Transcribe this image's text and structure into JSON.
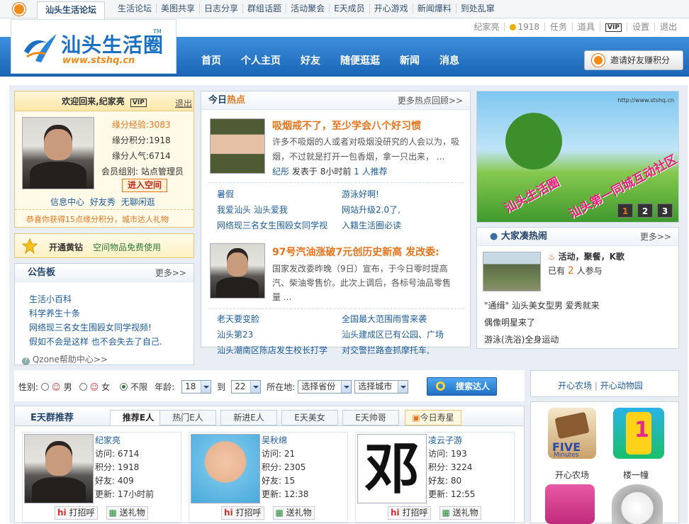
{
  "topbar": {
    "current_tab": "汕头生活论坛",
    "nav": [
      "生活论坛",
      "美图共享",
      "日志分享",
      "群组话题",
      "活动聚会",
      "E天成员",
      "开心游戏",
      "新闻爆料",
      "到处乱窜"
    ],
    "user": {
      "name": "纪家亮",
      "coins": "1918",
      "task": "任务",
      "props": "道具",
      "vip": "VIP",
      "settings": "设置",
      "logout": "退出"
    }
  },
  "header": {
    "logo_cn": "汕头生活圈",
    "logo_url": "www.stshq.cn",
    "logo_tm": "TM",
    "nav": [
      "首页",
      "个人主页",
      "好友",
      "随便逛逛",
      "新闻",
      "消息"
    ],
    "invite": "邀请好友赚积分"
  },
  "welcome": {
    "title": "欢迎回来,纪家亮",
    "vip": "VIP",
    "logout": "退出",
    "stats": [
      "缘分经验:3083",
      "缘分积分:1918",
      "缘分人气:6714"
    ],
    "group": "会员组别: 站点管理员",
    "enter": "进入空间",
    "links": [
      "信息中心",
      "好友秀",
      "无聊闲逛"
    ],
    "notice": "恭喜你获得15点缘分积分，城市达人礼物"
  },
  "yellow_diamond": {
    "title": "开通黄钻",
    "desc": "空间物品免费使用"
  },
  "board": {
    "title": "公告板",
    "more": "更多>>",
    "items": [
      "生活小百科",
      "科学养生十条",
      "网络现三名女生围殴女同学视频!",
      "假如不会是这样 也不会失去了自己."
    ],
    "help": "Qzone帮助中心>>"
  },
  "hot": {
    "title_a": "今日",
    "title_b": "热点",
    "more": "更多热点回顾>>",
    "story1": {
      "title": "吸烟戒不了，至少学会八个好习惯",
      "body": "许多不吸烟的人或者对吸烟没研究的人会以为，吸烟，不过就是打开一包香烟，拿一只出来，  ...",
      "author": "纪彤",
      "posted": "发表于",
      "time": "8小时前",
      "rec": "1 人推荐"
    },
    "links1": [
      "暑假",
      "游泳好啊!",
      "我爱汕头 汕头爱我",
      "网站升级2.0了,",
      "网络现三名女生围殴女同学视",
      "入籍生活圈必读"
    ],
    "story2": {
      "title": "97号汽油涨破7元创历史新高 发改委:",
      "body": "国家发改委昨晚（9日）宣布，于今日零时提高汽、柴油零售价。此次上调后，各标号油品零售量  ..."
    },
    "links2": [
      "老天要变脸",
      "全国最大范围雨雪来袭",
      "汕头第23",
      "汕头建成区已有公园、广场",
      "汕头潮南区陈店发生校长打学",
      "对交警拦路查抓摩托车,"
    ]
  },
  "banner": {
    "url": "http://www.stshq.cn",
    "text1": "汕头生活圈",
    "text2": "汕头第一同城互动社区",
    "pages": [
      "1",
      "2",
      "3"
    ]
  },
  "crowd": {
    "title": "大家凑热闹",
    "more": "更多>>",
    "event": "活动，聚餐，K歌",
    "joined_a": "已有",
    "joined_n": "2",
    "joined_b": "人参与",
    "items": [
      "\"通缉\" 汕头美女型男 爱秀就来",
      "偶像明星来了",
      "游泳(洗浴)全身运动"
    ]
  },
  "search": {
    "gender_label": "性别:",
    "male": "男",
    "female": "女",
    "any": "不限",
    "age_label": "年龄:",
    "age_from": "18",
    "age_to_label": "到",
    "age_to": "22",
    "loc_label": "所在地:",
    "province": "选择省份",
    "city": "选择城市",
    "button": "搜索达人"
  },
  "farm_links": [
    "开心农场",
    "开心动物园"
  ],
  "games": {
    "labels": [
      "开心农场",
      "楼一幢"
    ],
    "five": "FIVE",
    "minutes": "Minutes"
  },
  "etian": {
    "title": "E天群推荐",
    "tabs": [
      "推荐E人",
      "热门E人",
      "新进E人",
      "E天美女",
      "E天帅哥",
      "今日寿星"
    ],
    "cards": [
      {
        "name": "纪家亮",
        "visits": "访问: 6714",
        "points": "积分: 1918",
        "friends": "好友: 409",
        "updated": "更新: 17小时前"
      },
      {
        "name": "吴秋绵",
        "visits": "访问: 21",
        "points": "积分: 2305",
        "friends": "好友: 15",
        "updated": "更新: 12:38"
      },
      {
        "name": "凌云子游",
        "visits": "访问: 193",
        "points": "积分: 3224",
        "friends": "好友: 80",
        "updated": "更新: 12:55"
      }
    ],
    "greet": "打招呼",
    "gift": "送礼物",
    "ink_char": "邓"
  }
}
